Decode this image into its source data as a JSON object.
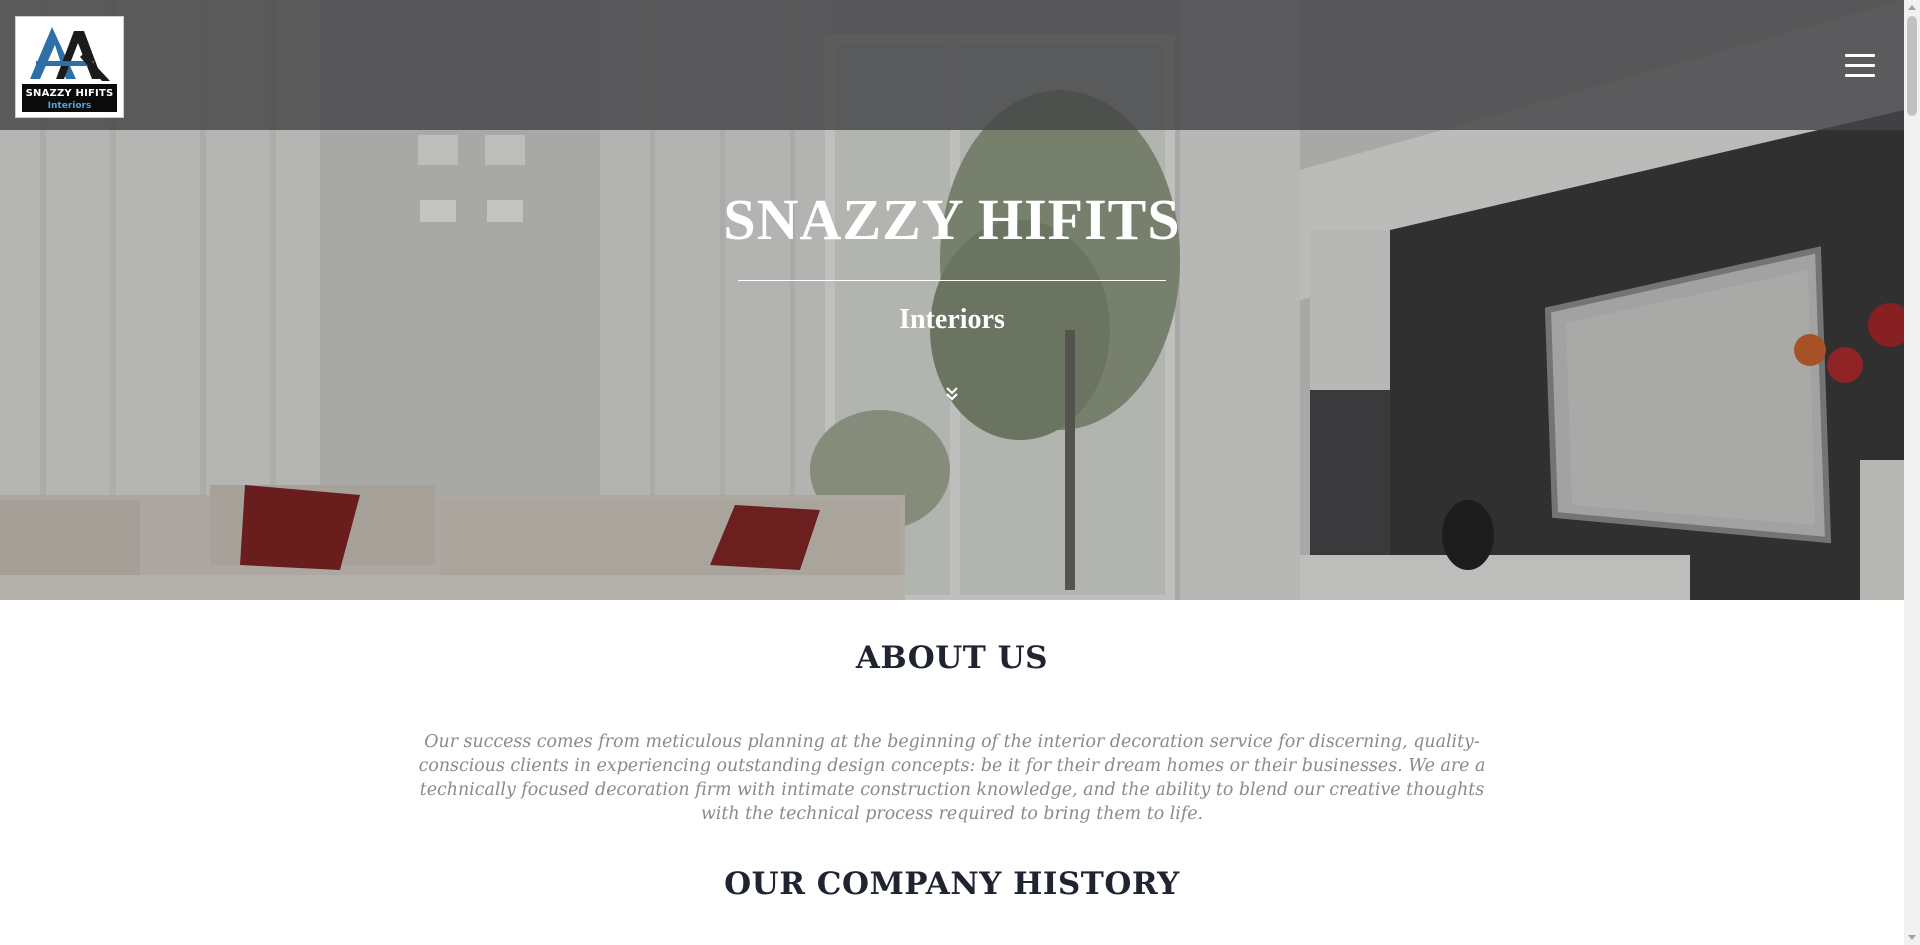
{
  "brand": {
    "logo_name": "SNAZZY HIFITS",
    "logo_sub": "Interiors"
  },
  "header": {
    "menu_icon": "hamburger-icon"
  },
  "hero": {
    "title": "SNAZZY HIFITS",
    "subtitle": "Interiors",
    "scroll_icon": "double-chevron-down-icon"
  },
  "about": {
    "heading": "ABOUT US",
    "text": "Our success comes from meticulous planning at the beginning of the interior decoration service for discerning, quality-conscious clients in experiencing outstanding design concepts: be it for their dream homes or their businesses. We are a technically focused decoration firm with intimate construction knowledge, and the ability to blend our creative thoughts with the technical process required to bring them to life."
  },
  "history": {
    "heading": "OUR COMPANY HISTORY"
  },
  "colors": {
    "heading": "#1f2430",
    "body_text": "#8a8a8a",
    "header_bar": "#464648",
    "logo_blue": "#2f6fa8"
  }
}
